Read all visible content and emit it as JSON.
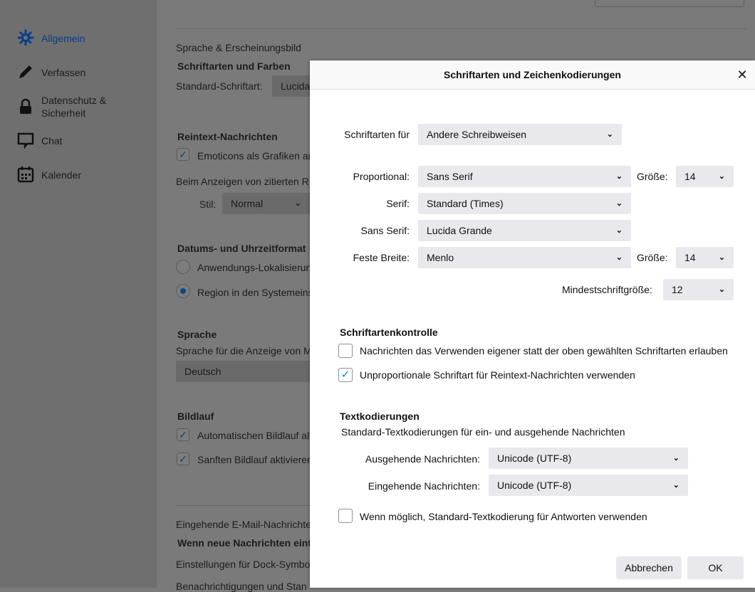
{
  "sidebar": {
    "items": [
      {
        "label": "Allgemein",
        "icon": "gear-icon"
      },
      {
        "label": "Verfassen",
        "icon": "pencil-icon"
      },
      {
        "label": "Datenschutz & Sicherheit",
        "icon": "lock-icon"
      },
      {
        "label": "Chat",
        "icon": "chat-icon"
      },
      {
        "label": "Kalender",
        "icon": "calendar-icon"
      }
    ]
  },
  "main": {
    "section_lang": "Sprache & Erscheinungsbild",
    "fonts_header": "Schriftarten und Farben",
    "default_font_label": "Standard-Schriftart:",
    "default_font_value": "Lucida",
    "plaintext_header": "Reintext-Nachrichten",
    "emoticons": "Emoticons als Grafiken an",
    "quoted": "Beim Anzeigen von zitierten R",
    "style_label": "Stil:",
    "style_value": "Normal",
    "date_header": "Datums- und Uhrzeitformat",
    "radio_app": "Anwendungs-Lokalisierun",
    "radio_region": "Region in den Systemeins",
    "lang_header": "Sprache",
    "lang_desc": "Sprache für die Anzeige von M",
    "lang_value": "Deutsch",
    "scroll_header": "Bildlauf",
    "autoscroll": "Automatischen Bildlauf al",
    "smooth": "Sanften Bildlauf aktivieren",
    "incoming_section": "Eingehende E-Mail-Nachrichte",
    "new_msgs": "Wenn neue Nachrichten eint",
    "dock": "Einstellungen für Dock-Symbo",
    "notif": "Benachrichtigungen und Stan"
  },
  "dialog": {
    "title": "Schriftarten und Zeichenkodierungen",
    "fonts_for_label": "Schriftarten für",
    "fonts_for_value": "Andere Schreibweisen",
    "proportional_label": "Proportional:",
    "proportional_value": "Sans Serif",
    "size_label": "Größe:",
    "proportional_size": "14",
    "serif_label": "Serif:",
    "serif_value": "Standard (Times)",
    "sans_label": "Sans Serif:",
    "sans_value": "Lucida Grande",
    "mono_label": "Feste Breite:",
    "mono_value": "Menlo",
    "mono_size": "14",
    "min_size_label": "Mindestschriftgröße:",
    "min_size_value": "12",
    "control_header": "Schriftartenkontrolle",
    "allow_own": "Nachrichten das Verwenden eigener statt der oben gewählten Schriftarten erlauben",
    "mono_plain": "Unproportionale Schriftart für Reintext-Nachrichten verwenden",
    "enc_header": "Textkodierungen",
    "enc_desc": "Standard-Textkodierungen für ein- und ausgehende Nachrichten",
    "outgoing_label": "Ausgehende Nachrichten:",
    "outgoing_value": "Unicode (UTF-8)",
    "incoming_label": "Eingehende Nachrichten:",
    "incoming_value": "Unicode (UTF-8)",
    "reply_default": "Wenn möglich, Standard-Textkodierung für Antworten verwenden",
    "cancel": "Abbrechen",
    "ok": "OK"
  }
}
